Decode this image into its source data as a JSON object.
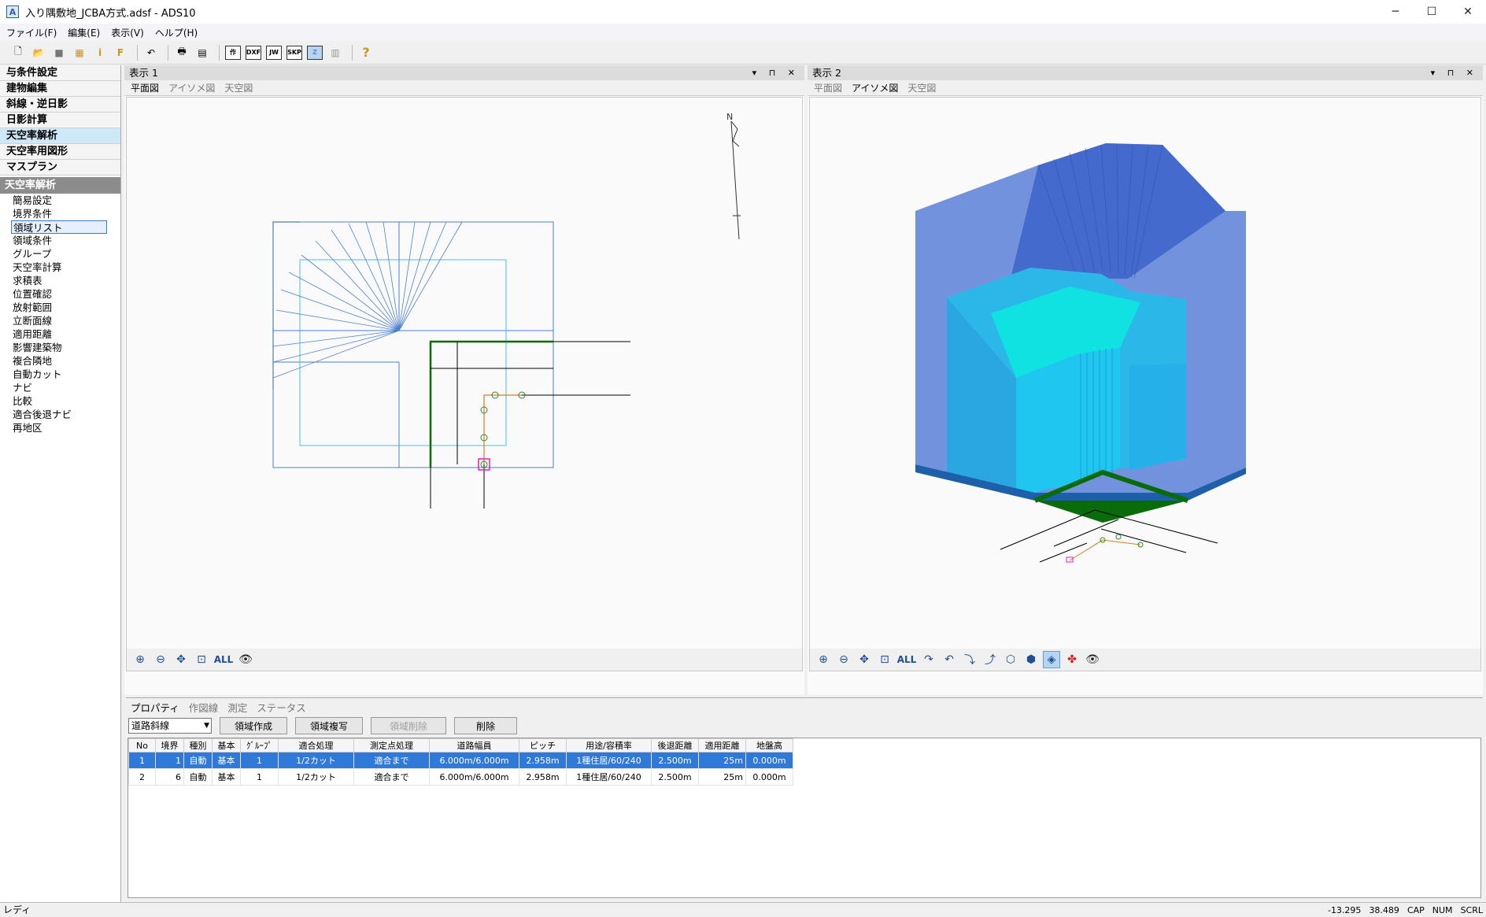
{
  "window": {
    "title": "入り隅敷地_JCBA方式.adsf - ADS10",
    "app_icon": "A"
  },
  "menu": [
    "ファイル(F)",
    "編集(E)",
    "表示(V)",
    "ヘルプ(H)"
  ],
  "toolbar": {
    "labels": {
      "create": "作",
      "dxf": "DXF",
      "jw": "JW",
      "skp": "SKP",
      "z": "Z",
      "help": "?"
    }
  },
  "sidebar": {
    "categories": [
      "与条件設定",
      "建物編集",
      "斜線・逆日影",
      "日影計算",
      "天空率解析",
      "天空率用図形",
      "マスプラン"
    ],
    "section_title": "天空率解析",
    "items": [
      "簡易設定",
      "境界条件",
      "領域リスト",
      "領域条件",
      "グループ",
      "天空率計算",
      "求積表",
      "位置確認",
      "放射範囲",
      "立断面線",
      "適用距離",
      "影響建築物",
      "複合隣地",
      "自動カット",
      "ナビ",
      "比較",
      "適合後退ナビ",
      "再地区"
    ]
  },
  "view1": {
    "title": "表示 1",
    "tabs": [
      "平面図",
      "アイソメ図",
      "天空図"
    ],
    "all_label": "ALL",
    "north": "N"
  },
  "view2": {
    "title": "表示 2",
    "tabs": [
      "平面図",
      "アイソメ図",
      "天空図"
    ],
    "all_label": "ALL"
  },
  "bottom": {
    "tabs": [
      "プロパティ",
      "作図線",
      "測定",
      "ステータス"
    ],
    "select_value": "道路斜線",
    "buttons": {
      "create": "領域作成",
      "copy": "領域複写",
      "delete_region": "領域削除",
      "delete": "削除"
    },
    "columns": [
      "No",
      "境界",
      "種別",
      "基本",
      "ｸﾞﾙｰﾌﾟ",
      "適合処理",
      "測定点処理",
      "道路幅員",
      "ピッチ",
      "用途/容積率",
      "後退距離",
      "適用距離",
      "地盤高"
    ],
    "rows": [
      [
        "1",
        "1",
        "自動",
        "基本",
        "1",
        "1/2カット",
        "適合まで",
        "6.000m/6.000m",
        "2.958m",
        "1種住居/60/240",
        "2.500m",
        "25m",
        "0.000m"
      ],
      [
        "2",
        "6",
        "自動",
        "基本",
        "1",
        "1/2カット",
        "適合まで",
        "6.000m/6.000m",
        "2.958m",
        "1種住居/60/240",
        "2.500m",
        "25m",
        "0.000m"
      ]
    ]
  },
  "status": {
    "left": "レディ",
    "x": "-13.295",
    "y": "38.489",
    "cap": "CAP",
    "num": "NUM",
    "scrl": "SCRL"
  }
}
